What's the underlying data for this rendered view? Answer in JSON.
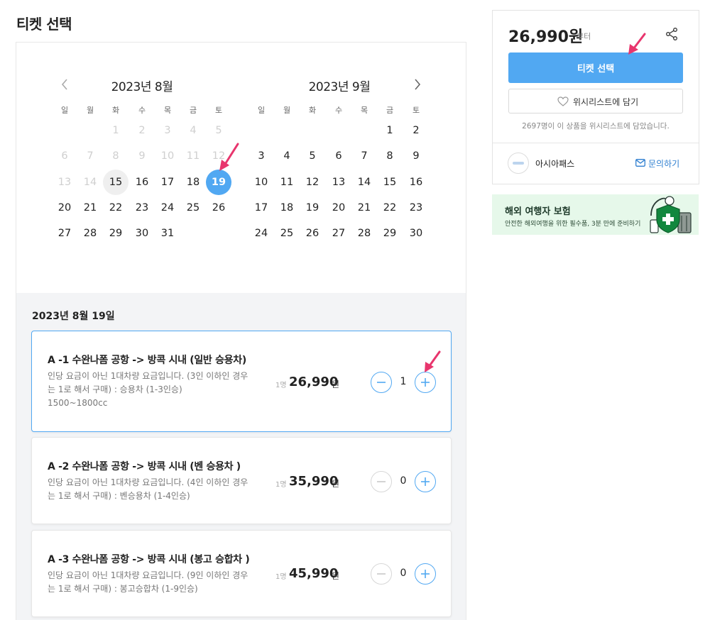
{
  "page": {
    "title": "티켓 선택"
  },
  "calendar": {
    "weekdays": [
      "일",
      "월",
      "화",
      "수",
      "목",
      "금",
      "토"
    ],
    "months": [
      {
        "title": "2023년 8월",
        "weeks": [
          [
            "",
            "",
            "1",
            "2",
            "3",
            "4",
            "5"
          ],
          [
            "6",
            "7",
            "8",
            "9",
            "10",
            "11",
            "12"
          ],
          [
            "13",
            "14",
            "15",
            "16",
            "17",
            "18",
            "19"
          ],
          [
            "20",
            "21",
            "22",
            "23",
            "24",
            "25",
            "26"
          ],
          [
            "27",
            "28",
            "29",
            "30",
            "31",
            "",
            ""
          ]
        ],
        "disabled_through": "14",
        "today": "15",
        "selected": "19"
      },
      {
        "title": "2023년 9월",
        "weeks": [
          [
            "",
            "",
            "",
            "",
            "",
            "1",
            "2"
          ],
          [
            "3",
            "4",
            "5",
            "6",
            "7",
            "8",
            "9"
          ],
          [
            "10",
            "11",
            "12",
            "13",
            "14",
            "15",
            "16"
          ],
          [
            "17",
            "18",
            "19",
            "20",
            "21",
            "22",
            "23"
          ],
          [
            "24",
            "25",
            "26",
            "27",
            "28",
            "29",
            "30"
          ]
        ]
      }
    ]
  },
  "options": {
    "selected_date": "2023년 8월 19일",
    "items": [
      {
        "title": "A -1 수완나폼 공항 -> 방콕 시내 (일반 승용차)",
        "desc": [
          "인당 요금이 아닌 1대차량 요금입니다. (3인 이하인 경우",
          "는 1로 해서 구매) : 승용차 (1-3인승)",
          "1500~1800cc"
        ],
        "per": "1명",
        "price": "26,990",
        "won": "원",
        "qty": "1"
      },
      {
        "title": "A -2 수완나폼 공항 -> 방콕 시내 (벤 승용차 )",
        "desc": [
          "인당 요금이 아닌 1대차량 요금입니다. (4인 이하인 경우",
          "는 1로 해서 구매) : 벤승용차 (1-4인승)"
        ],
        "per": "1명",
        "price": "35,990",
        "won": "원",
        "qty": "0"
      },
      {
        "title": "A -3 수완나폼 공항 -> 방콕 시내 (봉고 승합차 )",
        "desc": [
          "인당 요금이 아닌 1대차량 요금입니다. (9인 이하인 경우",
          "는 1로 해서 구매) : 봉고승합차 (1-9인승)"
        ],
        "per": "1명",
        "price": "45,990",
        "won": "원",
        "qty": "0"
      }
    ]
  },
  "sidebar": {
    "price": "26,990원",
    "from": "부터",
    "ticket_button": "티켓 선택",
    "wishlist_button": "위시리스트에 담기",
    "wishlist_count": "2697명이 이 상품을 위시리스트에 담았습니다.",
    "seller_name": "아시아패스",
    "inquiry": "문의하기"
  },
  "banner": {
    "title": "해외 여행자 보험",
    "subtitle": "안전한 해외여행을 위한 필수품, 3분 만에 준비하기"
  },
  "colors": {
    "accent": "#51a8f2",
    "annotation": "#e8356d",
    "banner_bg": "#e6f8ea"
  }
}
